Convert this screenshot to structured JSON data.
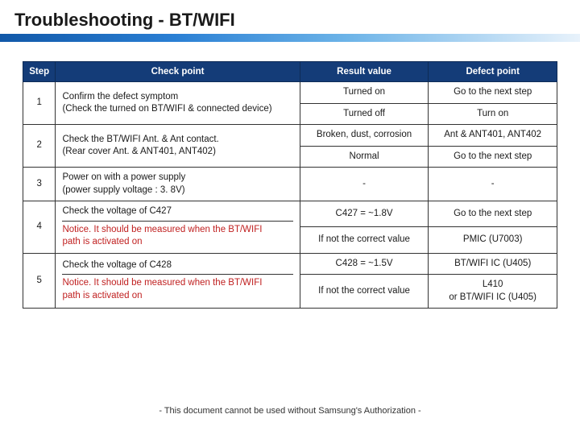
{
  "page": {
    "title": "Troubleshooting - BT/WIFI",
    "footer": "- This document cannot be used without Samsung's Authorization -"
  },
  "table": {
    "headers": {
      "step": "Step",
      "check": "Check point",
      "result": "Result value",
      "defect": "Defect point"
    },
    "rows": [
      {
        "step": "1",
        "check_l1": "Confirm the defect symptom",
        "check_l2": "(Check the turned on BT/WIFI & connected device)",
        "r1_result": "Turned on",
        "r1_defect": "Go to the next step",
        "r2_result": "Turned off",
        "r2_defect": "Turn on"
      },
      {
        "step": "2",
        "check_l1": "Check the BT/WIFI Ant. & Ant contact.",
        "check_l2": "(Rear cover Ant. & ANT401, ANT402)",
        "r1_result": "Broken, dust, corrosion",
        "r1_defect": "Ant & ANT401, ANT402",
        "r2_result": "Normal",
        "r2_defect": "Go to the next step"
      },
      {
        "step": "3",
        "check_l1": "Power on with a power supply",
        "check_l2": "(power supply voltage : 3. 8V)",
        "r1_result": "-",
        "r1_defect": "-"
      },
      {
        "step": "4",
        "check_main": "Check the voltage of C427",
        "notice_l1": "Notice. It should be measured when the BT/WIFI",
        "notice_l2": "path is activated on",
        "r1_result": "C427 = ~1.8V",
        "r1_defect": "Go to the next step",
        "r2_result": "If not the correct value",
        "r2_defect": "PMIC (U7003)"
      },
      {
        "step": "5",
        "check_main": "Check the voltage of C428",
        "notice_l1": "Notice. It should be measured when the BT/WIFI",
        "notice_l2": "path is activated on",
        "r1_result": "C428 = ~1.5V",
        "r1_defect": "BT/WIFI IC (U405)",
        "r2_result": "If not the correct value",
        "r2_defect": "L410\nor BT/WIFI IC (U405)"
      }
    ]
  }
}
